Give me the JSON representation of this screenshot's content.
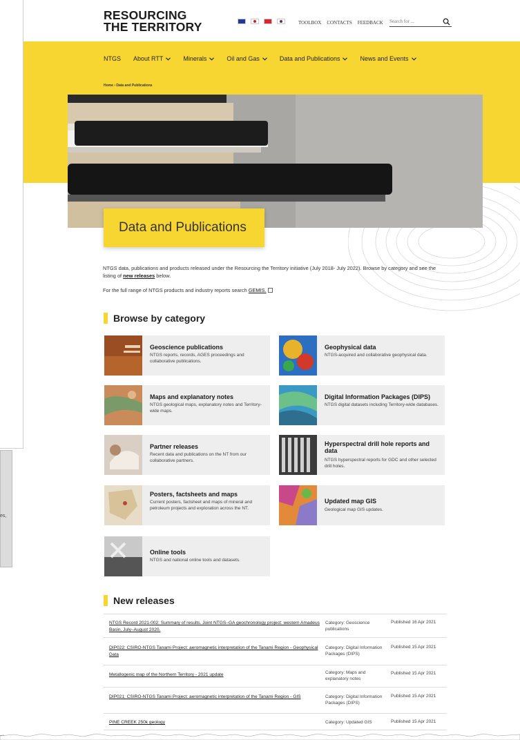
{
  "header": {
    "logo_line1": "RESOURCING",
    "logo_line2": "THE TERRITORY",
    "toplinks": [
      "TOOLBOX",
      "CONTACTS",
      "FEEDBACK"
    ],
    "search_placeholder": "Search for ..."
  },
  "nav": {
    "items": [
      "NTGS",
      "About RTT",
      "Minerals",
      "Oil and Gas",
      "Data and Publications",
      "News and Events"
    ]
  },
  "breadcrumb": "Home  ›  Data and Publications",
  "page_title": "Data and Publications",
  "intro": {
    "text1": "NTGS data, publications and products released under the Resourcing the Territory initiative (July 2018- July 2022). Browse by category and see the listing of ",
    "link1": "new releases",
    "text1_end": " below.",
    "text2": "For the full range of NTGS products and industry reports search ",
    "link2": "GEMIS."
  },
  "browse_heading": "Browse by category",
  "categories": [
    {
      "title": "Geoscience publications",
      "desc": "NTGS reports, records, AGES proceedings and collaborative publications."
    },
    {
      "title": "Geophysical data",
      "desc": "NTGS-acquired and collaborative geophysical data."
    },
    {
      "title": "Maps and explanatory notes",
      "desc": "NTGS geological maps, explanatory notes and Territory-wide maps."
    },
    {
      "title": "Digital Information Packages (DIPS)",
      "desc": "NTGS digital datasets including Territory-wide databases."
    },
    {
      "title": "Partner releases",
      "desc": "Recent data and publications on the NT from our collaborative partners."
    },
    {
      "title": "Hyperspectral drill hole reports and data",
      "desc": "NTGS hyperspectral reports for GDC and other selected drill holes."
    },
    {
      "title": "Posters, factsheets and maps",
      "desc": "Current posters, factsheet and maps of mineral and petroleum projects and exploration across the NT."
    },
    {
      "title": "Updated map GIS",
      "desc": "Geological map GIS updates."
    },
    {
      "title": "Online tools",
      "desc": "NTGS and national online tools and datasets."
    }
  ],
  "releases_heading": "New releases",
  "releases": [
    {
      "title": "NTGS Record 2021-002: Summary of results. Joint NTGS–GA geochronology project: western Amadeus Basin, July–August 2020.",
      "category": "Category: Geoscience publications",
      "date": "Published 16 Apr 2021"
    },
    {
      "title": "DIP022: CSIRO-NTGS Tanami Project: aeromagnetic interpretation of the Tanami Region - Geophysical Data",
      "category": "Category: Digital Information Packages (DIPS)",
      "date": "Published 15 Apr 2021"
    },
    {
      "title": "Metallogenic map of the Northern Territory - 2021 update",
      "category": "Category: Maps and explanatory notes",
      "date": "Published 15 Apr 2021"
    },
    {
      "title": "DIP021: CSIRO-NTGS Tanami Project: aeromagnetic interpretation of the Tanami Region - GIS",
      "category": "Category: Digital Information Packages (DIPS)",
      "date": "Published 15 Apr 2021"
    },
    {
      "title": "PINE CREEK 250k geology",
      "category": "Category: Updated GIS",
      "date": "Published 15 Apr 2021"
    }
  ],
  "background": {
    "fragment1": "es,",
    "fragment2": "nt"
  }
}
